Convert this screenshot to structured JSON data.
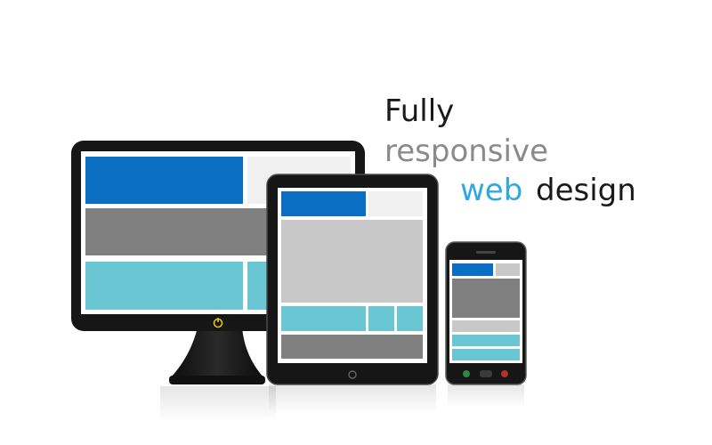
{
  "headline": {
    "line1": "Fully",
    "line2": "responsive",
    "line3_accent": "web",
    "line3_rest": "design"
  },
  "colors": {
    "accent_text": "#2fa8e0",
    "dark_text": "#1a1a1a",
    "gray_text": "#8a8a8a",
    "block_blue": "#0a6fc2",
    "block_gray": "#808080",
    "block_light_gray": "#c8c8c8",
    "block_pale": "#f0f0f0",
    "block_teal": "#6ac6d2",
    "device_body": "#161616",
    "power_led": "#e0c020"
  },
  "devices": [
    "desktop-monitor",
    "tablet",
    "smartphone"
  ],
  "icons": [
    "power-icon",
    "home-button-icon",
    "call-icon",
    "menu-icon",
    "end-call-icon"
  ]
}
